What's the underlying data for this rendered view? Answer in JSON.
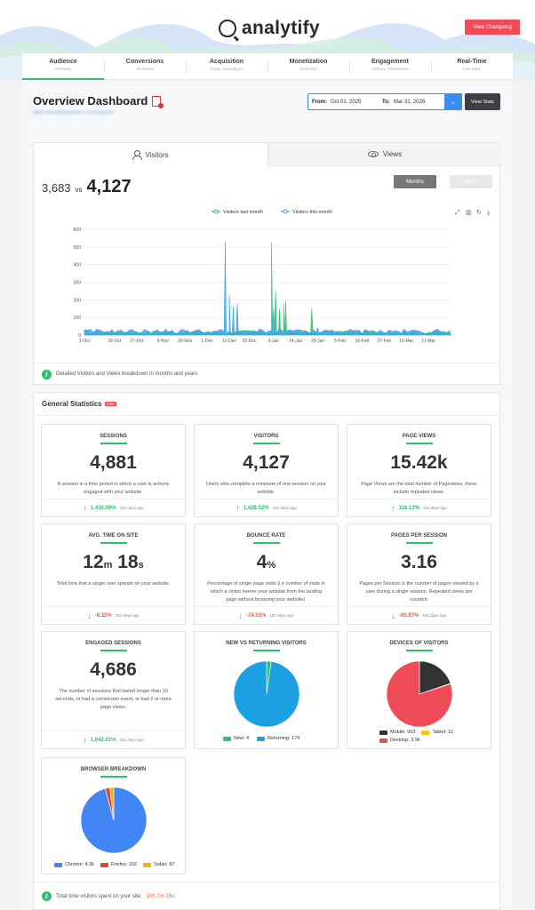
{
  "header": {
    "logo_text": "analytify",
    "changelog_label": "View Changelog"
  },
  "tabs": [
    {
      "title": "Audience",
      "sub": "Overview"
    },
    {
      "title": "Conversions",
      "sub": "All Events"
    },
    {
      "title": "Acquisition",
      "sub": "Goals, Campaigns"
    },
    {
      "title": "Monetization",
      "sub": "Overview"
    },
    {
      "title": "Engagement",
      "sub": "Authors, Dimensions"
    },
    {
      "title": "Real-Time",
      "sub": "Live Stats"
    }
  ],
  "dashboard": {
    "title": "Overview Dashboard",
    "site_url": "https://analytifywpdemo.com/analytify",
    "from_label": "From:",
    "from_value": "Oct 01, 2025",
    "to_label": "To:",
    "to_value": "Mar 31, 2026",
    "view_stats_label": "View Stats"
  },
  "visitors_chart": {
    "tab_visitors": "Visitors",
    "tab_views": "Views",
    "compare_prev": "3,683",
    "compare_vs": "vs",
    "compare_current": "4,127",
    "btn_months": "Months",
    "btn_years": "Years",
    "note": "Detailed Visitors and Views breakdown in months and years"
  },
  "chart_data": {
    "type": "area",
    "series": [
      {
        "name": "Visitors last month",
        "color": "#2ac16f"
      },
      {
        "name": "Visitors this month",
        "color": "#3ea6e8"
      }
    ],
    "x_ticks": [
      "1-Oct",
      "16-Oct",
      "27-Oct",
      "9-Nov",
      "20-Nov",
      "1-Dec",
      "12-Dec",
      "22-Dec",
      "3-Jan",
      "14-Jan",
      "25-Jan",
      "5-Feb",
      "16-Feb",
      "27-Feb",
      "10-Mar",
      "21-Mar"
    ],
    "y_ticks": [
      0,
      100,
      200,
      300,
      400,
      500,
      600
    ],
    "ylim": [
      0,
      600
    ],
    "spikes_this_month": [
      {
        "x": "10-Dec",
        "y": 530
      },
      {
        "x": "12-Dec",
        "y": 230
      },
      {
        "x": "14-Dec",
        "y": 160
      },
      {
        "x": "16-Dec",
        "y": 180
      },
      {
        "x": "3-Jan",
        "y": 150
      },
      {
        "x": "25-Jan",
        "y": 40
      }
    ],
    "spikes_last_month": [
      {
        "x": "2-Jan",
        "y": 525
      },
      {
        "x": "4-Jan",
        "y": 250
      },
      {
        "x": "6-Jan",
        "y": 150
      },
      {
        "x": "8-Jan",
        "y": 180
      },
      {
        "x": "9-Jan",
        "y": 195
      },
      {
        "x": "22-Jan",
        "y": 150
      }
    ]
  },
  "general_stats": {
    "title": "General Statistics",
    "csv": "CSV",
    "cards": [
      {
        "label": "SESSIONS",
        "value": "4,881",
        "desc": "A session is a time period in which a user is actively engaged with your website.",
        "change": "1,430.09%",
        "dir": "up",
        "ago": "181 days ago"
      },
      {
        "label": "VISITORS",
        "value": "4,127",
        "desc": "Users who complete a minimum of one session on your website.",
        "change": "1,428.52%",
        "dir": "up",
        "ago": "181 days ago"
      },
      {
        "label": "PAGE VIEWS",
        "value": "15.42k",
        "desc": "Page Views are the total number of Pageviews, these include repeated views.",
        "change": "116.13%",
        "dir": "up",
        "ago": "181 days ago"
      },
      {
        "label": "AVG. TIME ON SITE",
        "value_min": "12",
        "unit_min": "m",
        "value_sec": "18",
        "unit_sec": "s",
        "desc": "Total time that a single user spends on your website.",
        "change": "-8.32%",
        "dir": "down",
        "ago": "181 days ago"
      },
      {
        "label": "BOUNCE RATE",
        "value": "4",
        "unit": "%",
        "desc": "Percentage of single page visits (i.e number of visits in which a visitor leaves your website from the landing page without browsing your website).",
        "change": "-74.51%",
        "dir": "down",
        "ago": "181 days ago"
      },
      {
        "label": "PAGES PER SESSION",
        "value": "3.16",
        "desc": "Pages per Session is the number of pages viewed by a user during a single session. Repeated views are counted.",
        "change": "-85.87%",
        "dir": "down",
        "ago": "181 days ago"
      },
      {
        "label": "ENGAGED SESSIONS",
        "value": "4,686",
        "desc": "The number of sessions that lasted longer than 10 seconds, or had a conversion event, or had 2 or more page views.",
        "change": "1,642.01%",
        "dir": "up",
        "ago": "181 days ago"
      }
    ],
    "new_vs_returning": {
      "label": "NEW VS RETURNING VISITORS",
      "slices": [
        {
          "name": "New",
          "text": "New: 4",
          "value": 4,
          "color": "#2ac16f"
        },
        {
          "name": "Returning",
          "text": "Returning: 174",
          "value": 174,
          "color": "#1ba1e2"
        }
      ]
    },
    "devices": {
      "label": "DEVICES OF VISITORS",
      "slices": [
        {
          "name": "Mobile",
          "text": "Mobile: 963",
          "value": 963,
          "color": "#333333"
        },
        {
          "name": "Tablet",
          "text": "Tablet: 11",
          "value": 11,
          "color": "#f5c518"
        },
        {
          "name": "Desktop",
          "text": "Desktop: 3.9k",
          "value": 3900,
          "color": "#ef4c58"
        }
      ]
    },
    "browsers": {
      "label": "BROWSER BREAKDOWN",
      "slices": [
        {
          "name": "Chrome",
          "text": "Chrome: 4.3k",
          "value": 4300,
          "color": "#4285f4"
        },
        {
          "name": "Firefox",
          "text": "Firefox: 102",
          "value": 102,
          "color": "#ea4335"
        },
        {
          "name": "Safari",
          "text": "Safari: 87",
          "value": 87,
          "color": "#f4b400"
        }
      ]
    },
    "time_note_prefix": "Total time visitors spent on your site:",
    "time_note_value": "10h 7m 15s."
  }
}
